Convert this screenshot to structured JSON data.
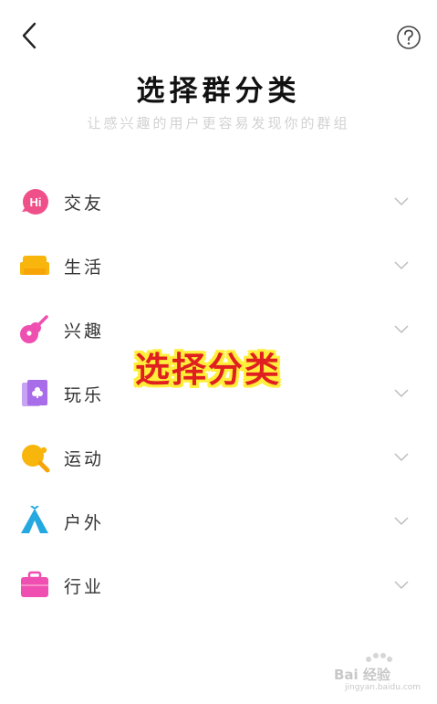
{
  "header": {
    "title": "选择群分类",
    "subtitle": "让感兴趣的用户更容易发现你的群组"
  },
  "categories": [
    {
      "label": "交友",
      "icon": "hi-chat-bubble-icon",
      "icon_color": "#f0508a",
      "icon_text": "Hi"
    },
    {
      "label": "生活",
      "icon": "sofa-icon",
      "icon_color": "#f8b60c"
    },
    {
      "label": "兴趣",
      "icon": "guitar-icon",
      "icon_color": "#ee4fb1"
    },
    {
      "label": "玩乐",
      "icon": "playing-card-icon",
      "icon_color": "#a86de8"
    },
    {
      "label": "运动",
      "icon": "ping-pong-paddle-icon",
      "icon_color": "#f8b60c"
    },
    {
      "label": "户外",
      "icon": "tent-icon",
      "icon_color": "#24a8e0"
    },
    {
      "label": "行业",
      "icon": "briefcase-icon",
      "icon_color": "#ee4fb1"
    }
  ],
  "overlay": {
    "text": "选择分类"
  },
  "watermark": {
    "text": "Bai 经验",
    "sub": "jingyan.baidu.com"
  }
}
